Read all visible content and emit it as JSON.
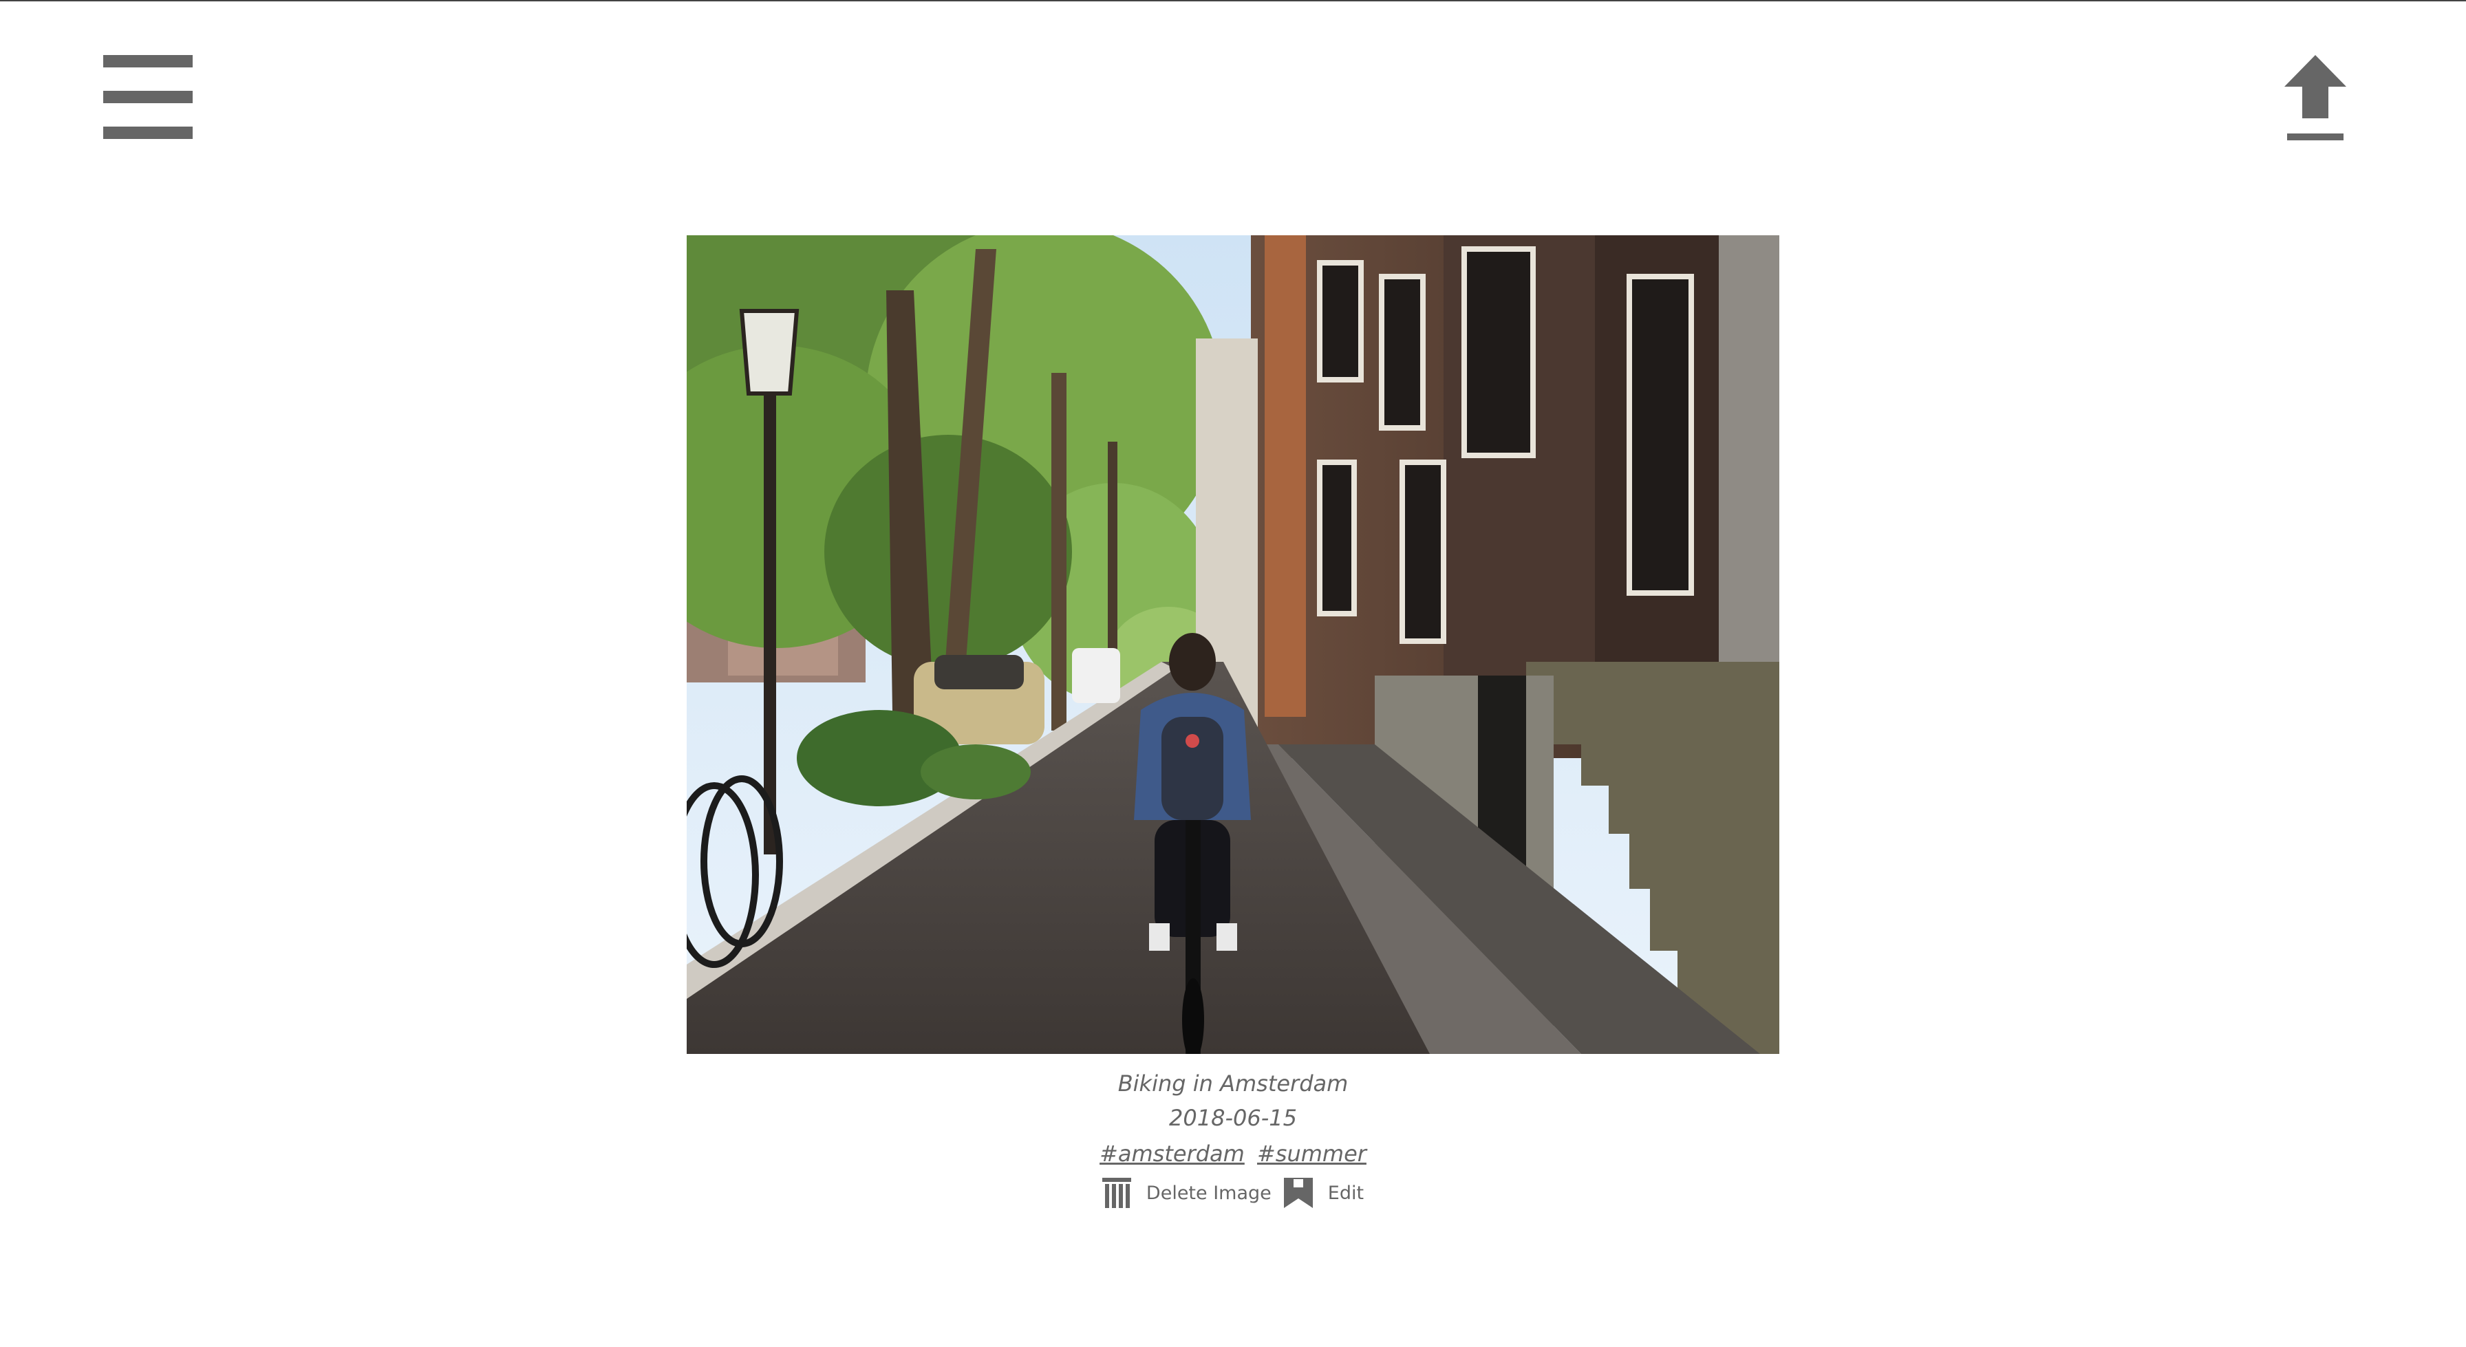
{
  "header": {
    "menu_icon": "hamburger-menu-icon",
    "upload_icon": "upload-arrow-icon"
  },
  "photo": {
    "subject": "Cyclist riding down a tree-lined Amsterdam canal street",
    "caption": "Biking in Amsterdam",
    "date": "2018-06-15",
    "tags": [
      "#amsterdam",
      "#summer"
    ]
  },
  "actions": {
    "delete_label": "Delete Image",
    "delete_icon": "trash-icon",
    "edit_label": "Edit",
    "edit_icon": "bookmark-icon"
  },
  "colors": {
    "icon": "#666666",
    "text": "#666666",
    "background": "#ffffff"
  }
}
